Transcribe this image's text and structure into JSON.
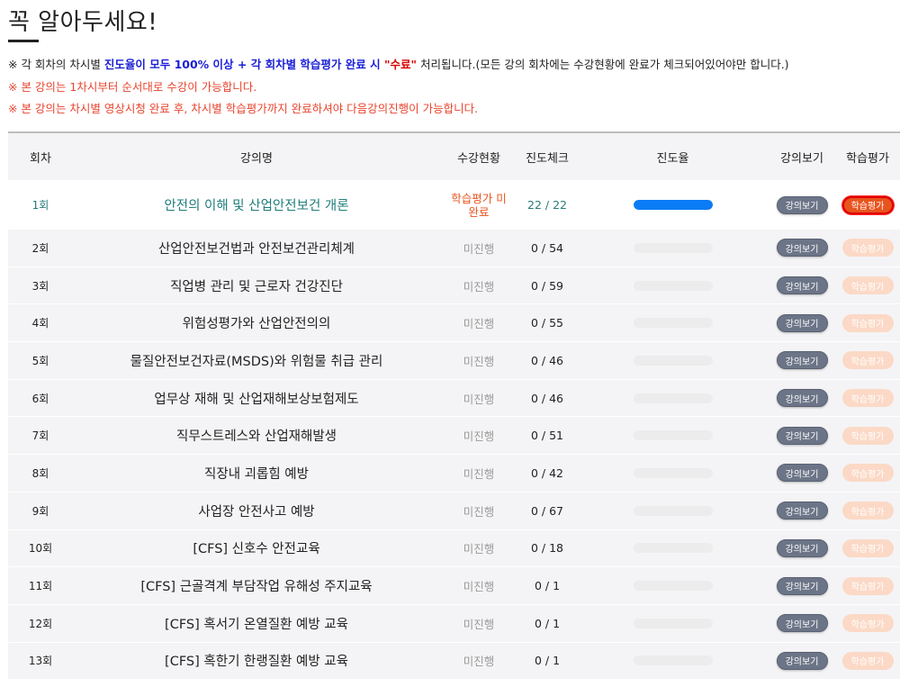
{
  "title": "꼭 알아두세요!",
  "notices": {
    "line1": {
      "prefix": "※ 각 회차의 차시별 ",
      "blue": "진도율이 모두 100% 이상 + 각 회차별 학습평가 완료 시 ",
      "red": "\"수료\"",
      "suffix": " 처리됩니다.(모든 강의 회차에는 수강현황에 완료가 체크되어있어야만 합니다.)"
    },
    "line2": "※ 본 강의는 1차시부터 순서대로 수강이 가능합니다.",
    "line3": "※ 본 강의는 차시별 영상시청 완료 후, 차시별 학습평가까지 완료하셔야 다음강의진행이 가능합니다."
  },
  "columns": {
    "round": "회차",
    "name": "강의명",
    "status": "수강현황",
    "check": "진도체크",
    "rate": "진도율",
    "view": "강의보기",
    "eval": "학습평가"
  },
  "colors": {
    "progress_fill": "#0a7cf5",
    "view_button": "#6c7587",
    "eval_active": "#e8541e",
    "eval_disabled": "#fbd9c6",
    "status_active": "#e8541e",
    "first_row_text": "#1f7d7a"
  },
  "rows": [
    {
      "round": "1회",
      "name": "안전의 이해 및 산업안전보건 개론",
      "status": "학습평가 미완료",
      "check": "22 / 22",
      "progress": 1.0,
      "view": "강의보기",
      "eval": "학습평가"
    },
    {
      "round": "2회",
      "name": "산업안전보건법과 안전보건관리체계",
      "status": "미진행",
      "check": "0 / 54",
      "progress": 0,
      "view": "강의보기",
      "eval": "학습평가"
    },
    {
      "round": "3회",
      "name": "직업병 관리 및 근로자 건강진단",
      "status": "미진행",
      "check": "0 / 59",
      "progress": 0,
      "view": "강의보기",
      "eval": "학습평가"
    },
    {
      "round": "4회",
      "name": "위험성평가와 산업안전의의",
      "status": "미진행",
      "check": "0 / 55",
      "progress": 0,
      "view": "강의보기",
      "eval": "학습평가"
    },
    {
      "round": "5회",
      "name": "물질안전보건자료(MSDS)와 위험물 취급 관리",
      "status": "미진행",
      "check": "0 / 46",
      "progress": 0,
      "view": "강의보기",
      "eval": "학습평가"
    },
    {
      "round": "6회",
      "name": "업무상 재해 및 산업재해보상보험제도",
      "status": "미진행",
      "check": "0 / 46",
      "progress": 0,
      "view": "강의보기",
      "eval": "학습평가"
    },
    {
      "round": "7회",
      "name": "직무스트레스와 산업재해발생",
      "status": "미진행",
      "check": "0 / 51",
      "progress": 0,
      "view": "강의보기",
      "eval": "학습평가"
    },
    {
      "round": "8회",
      "name": "직장내 괴롭힘 예방",
      "status": "미진행",
      "check": "0 / 42",
      "progress": 0,
      "view": "강의보기",
      "eval": "학습평가"
    },
    {
      "round": "9회",
      "name": "사업장 안전사고 예방",
      "status": "미진행",
      "check": "0 / 67",
      "progress": 0,
      "view": "강의보기",
      "eval": "학습평가"
    },
    {
      "round": "10회",
      "name": "[CFS] 신호수 안전교육",
      "status": "미진행",
      "check": "0 / 18",
      "progress": 0,
      "view": "강의보기",
      "eval": "학습평가"
    },
    {
      "round": "11회",
      "name": "[CFS] 근골격계 부담작업 유해성 주지교육",
      "status": "미진행",
      "check": "0 / 1",
      "progress": 0,
      "view": "강의보기",
      "eval": "학습평가"
    },
    {
      "round": "12회",
      "name": "[CFS] 혹서기 온열질환 예방 교육",
      "status": "미진행",
      "check": "0 / 1",
      "progress": 0,
      "view": "강의보기",
      "eval": "학습평가"
    },
    {
      "round": "13회",
      "name": "[CFS] 혹한기 한랭질환 예방 교육",
      "status": "미진행",
      "check": "0 / 1",
      "progress": 0,
      "view": "강의보기",
      "eval": "학습평가"
    }
  ]
}
